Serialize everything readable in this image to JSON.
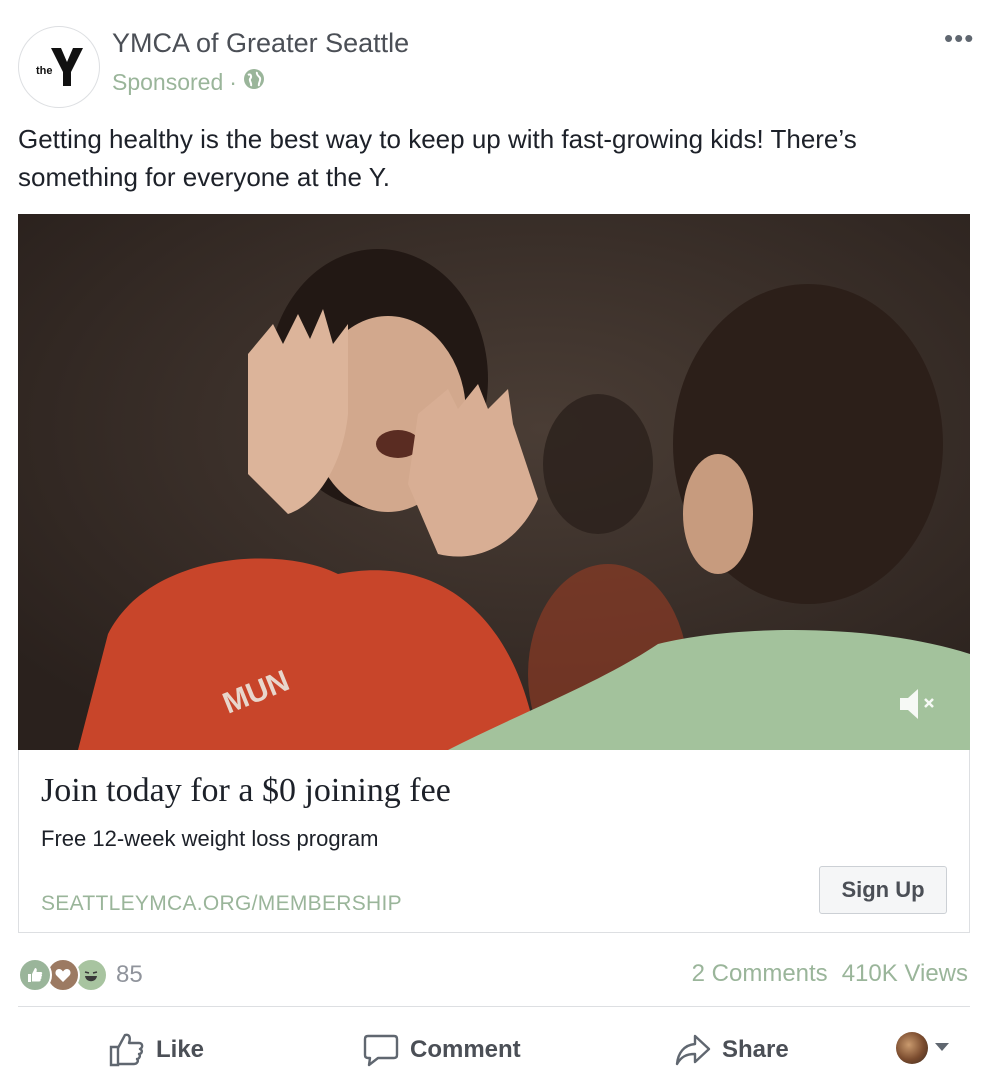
{
  "header": {
    "logo_text": "the Y",
    "page_name": "YMCA of Greater Seattle",
    "sponsored_label": "Sponsored",
    "separator": "·",
    "more_label": "•••"
  },
  "caption": "Getting healthy is the best way to keep up with fast-growing kids! There’s something for everyone at the Y.",
  "card": {
    "headline": "Join today for a $0 joining fee",
    "description": "Free 12-week weight loss program",
    "domain": "SEATTLEYMCA.ORG/MEMBERSHIP",
    "cta_label": "Sign Up"
  },
  "stats": {
    "reaction_count": "85",
    "comments": "2 Comments",
    "views": "410K Views"
  },
  "actions": {
    "like": "Like",
    "comment": "Comment",
    "share": "Share"
  },
  "colors": {
    "accent_green": "#9ab59a",
    "text_primary": "#1d2129",
    "text_secondary": "#4b4f56",
    "border": "#dddfe2"
  },
  "icons": {
    "globe": "globe-icon",
    "mute": "mute-icon",
    "like": "thumbs-up-icon",
    "comment": "speech-bubble-icon",
    "share": "share-arrow-icon",
    "reactions": [
      "like-reaction-icon",
      "love-reaction-icon",
      "haha-reaction-icon"
    ]
  }
}
